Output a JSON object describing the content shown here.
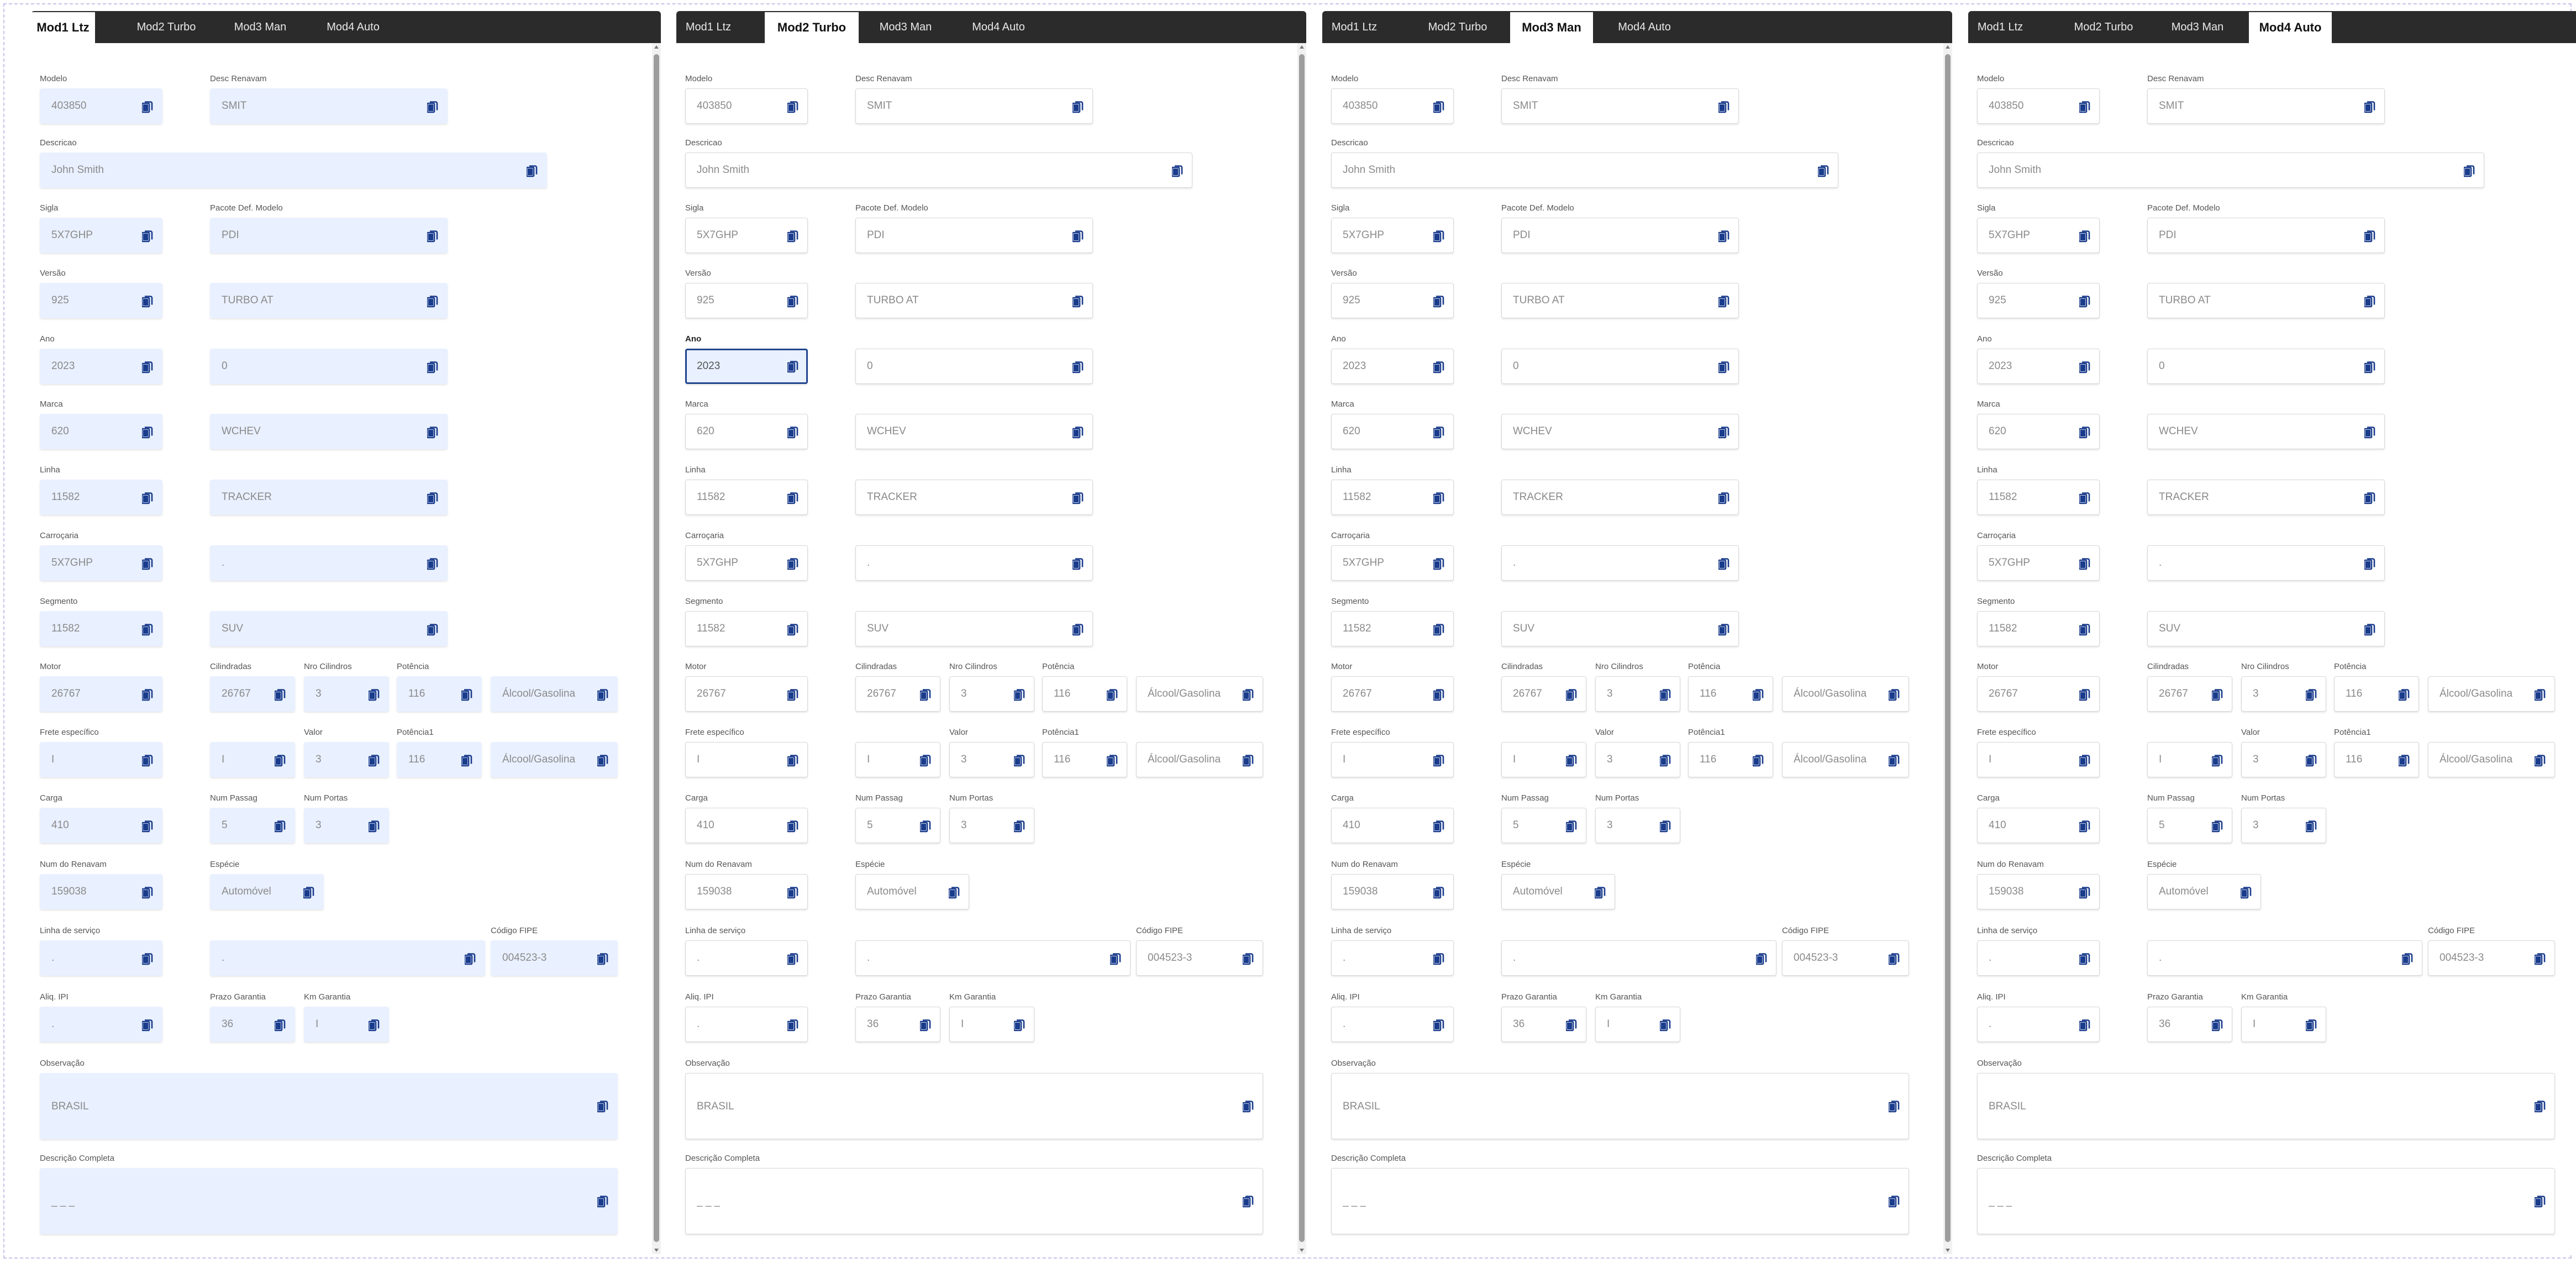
{
  "panels": [
    {
      "tabs": [
        {
          "label": "Mod1 Ltz",
          "active": true
        },
        {
          "label": "Mod2 Turbo",
          "active": false
        },
        {
          "label": "Mod3 Man",
          "active": false
        },
        {
          "label": "Mod4 Auto",
          "active": false
        }
      ],
      "filled": true,
      "focused_field": ""
    },
    {
      "tabs": [
        {
          "label": "Mod1 Ltz",
          "active": false
        },
        {
          "label": "Mod2 Turbo",
          "active": true
        },
        {
          "label": "Mod3 Man",
          "active": false
        },
        {
          "label": "Mod4 Auto",
          "active": false
        }
      ],
      "filled": false,
      "focused_field": "ano"
    },
    {
      "tabs": [
        {
          "label": "Mod1 Ltz",
          "active": false
        },
        {
          "label": "Mod2 Turbo",
          "active": false
        },
        {
          "label": "Mod3 Man",
          "active": true
        },
        {
          "label": "Mod4 Auto",
          "active": false
        }
      ],
      "filled": false,
      "focused_field": ""
    },
    {
      "tabs": [
        {
          "label": "Mod1 Ltz",
          "active": false
        },
        {
          "label": "Mod2 Turbo",
          "active": false
        },
        {
          "label": "Mod3 Man",
          "active": false
        },
        {
          "label": "Mod4 Auto",
          "active": true
        }
      ],
      "filled": false,
      "focused_field": ""
    }
  ],
  "form": {
    "modelo": {
      "label": "Modelo",
      "value": "403850"
    },
    "desc_renavam": {
      "label": "Desc Renavam",
      "value": "SMIT"
    },
    "descricao": {
      "label": "Descricao",
      "value": "John Smith"
    },
    "sigla": {
      "label": "Sigla",
      "value": "5X7GHP"
    },
    "pacote": {
      "label": "Pacote Def. Modelo",
      "value": "PDI"
    },
    "versao": {
      "label": "Versão",
      "value": "925"
    },
    "versao_desc": {
      "label": "",
      "value": "TURBO AT"
    },
    "ano": {
      "label": "Ano",
      "value": "2023"
    },
    "ano_desc": {
      "label": "",
      "value": "0"
    },
    "marca": {
      "label": "Marca",
      "value": "620"
    },
    "marca_desc": {
      "label": "",
      "value": "WCHEV"
    },
    "linha": {
      "label": "Linha",
      "value": "11582"
    },
    "linha_desc": {
      "label": "",
      "value": "TRACKER"
    },
    "carrocaria": {
      "label": "Carroçaria",
      "value": "5X7GHP"
    },
    "carrocaria_desc": {
      "label": "",
      "value": "."
    },
    "segmento": {
      "label": "Segmento",
      "value": "11582"
    },
    "segmento_desc": {
      "label": "",
      "value": "SUV"
    },
    "motor": {
      "label": "Motor",
      "value": "26767"
    },
    "cilindradas": {
      "label": "Cilindradas",
      "value": "26767"
    },
    "nro_cilindros": {
      "label": "Nro Cilindros",
      "value": "3"
    },
    "potencia": {
      "label": "Potência",
      "value": "116"
    },
    "combustivel": {
      "label": "",
      "value": "Álcool/Gasolina"
    },
    "frete": {
      "label": "Frete específico",
      "value": "I"
    },
    "frete_desc": {
      "label": "",
      "value": "I"
    },
    "valor": {
      "label": "Valor",
      "value": "3"
    },
    "potencia1": {
      "label": "Potência1",
      "value": "116"
    },
    "combustivel1": {
      "label": "",
      "value": "Álcool/Gasolina"
    },
    "carga": {
      "label": "Carga",
      "value": "410"
    },
    "num_passag": {
      "label": "Num Passag",
      "value": "5"
    },
    "num_portas": {
      "label": "Num Portas",
      "value": "3"
    },
    "num_renavam": {
      "label": "Num do Renavam",
      "value": "159038"
    },
    "especie": {
      "label": "Espécie",
      "value": "Automóvel"
    },
    "linha_servico": {
      "label": "Linha de serviço",
      "value": "."
    },
    "linha_servico_desc": {
      "label": "",
      "value": "."
    },
    "codigo_fipe": {
      "label": "Código FIPE",
      "value": "004523-3"
    },
    "aliq_ipi": {
      "label": "Aliq. IPI",
      "value": "."
    },
    "prazo_garantia": {
      "label": "Prazo Garantia",
      "value": "36"
    },
    "km_garantia": {
      "label": "Km Garantia",
      "value": "I"
    },
    "observacao": {
      "label": "Observação",
      "value": "BRASIL"
    },
    "descricao_completa": {
      "label": "Descrição Completa",
      "value": "_ _ _"
    }
  },
  "icons": {
    "field_action": "copy-icon",
    "accent": "#1a3c8c"
  }
}
